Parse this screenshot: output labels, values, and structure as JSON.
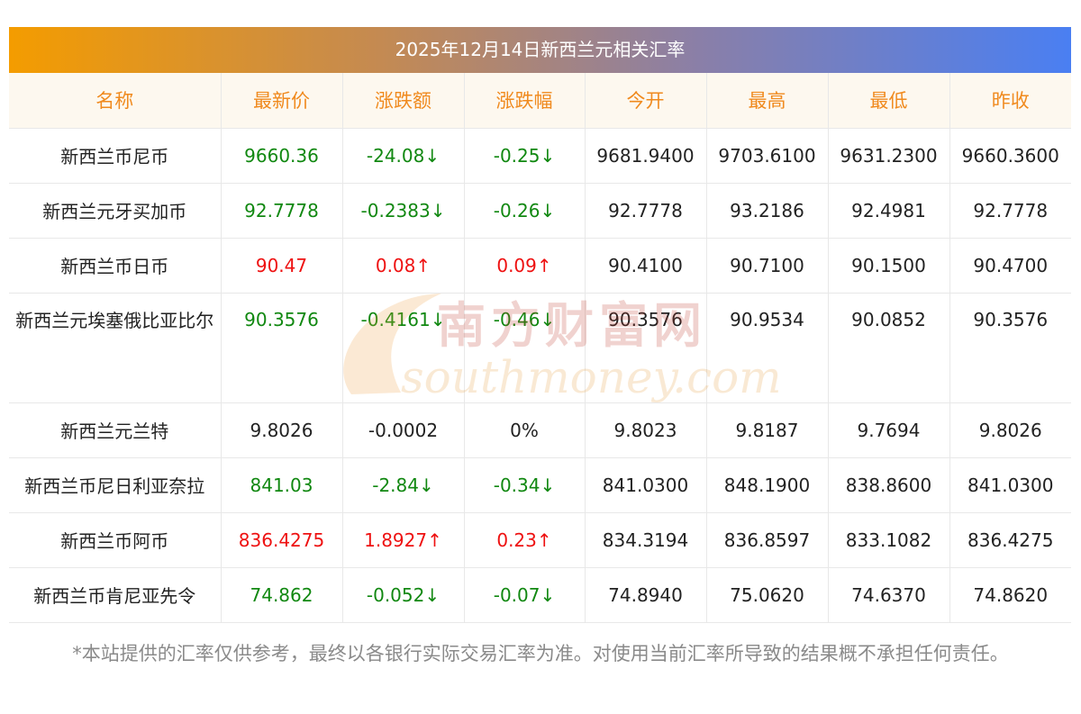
{
  "title": "2025年12月14日新西兰元相关汇率",
  "headers": [
    "名称",
    "最新价",
    "涨跌额",
    "涨跌幅",
    "今开",
    "最高",
    "最低",
    "昨收"
  ],
  "rows": [
    {
      "name": "新西兰币尼币",
      "latest": "9660.36",
      "change": "-24.08↓",
      "pct": "-0.25↓",
      "open": "9681.9400",
      "high": "9703.6100",
      "low": "9631.2300",
      "prev": "9660.3600",
      "trend": "down"
    },
    {
      "name": "新西兰元牙买加币",
      "latest": "92.7778",
      "change": "-0.2383↓",
      "pct": "-0.26↓",
      "open": "92.7778",
      "high": "93.2186",
      "low": "92.4981",
      "prev": "92.7778",
      "trend": "down"
    },
    {
      "name": "新西兰币日币",
      "latest": "90.47",
      "change": "0.08↑",
      "pct": "0.09↑",
      "open": "90.4100",
      "high": "90.7100",
      "low": "90.1500",
      "prev": "90.4700",
      "trend": "up"
    },
    {
      "name": "新西兰元埃塞俄比亚比尔",
      "latest": "90.3576",
      "change": "-0.4161↓",
      "pct": "-0.46↓",
      "open": "90.3576",
      "high": "90.9534",
      "low": "90.0852",
      "prev": "90.3576",
      "trend": "down"
    },
    {
      "name": "新西兰元兰特",
      "latest": "9.8026",
      "change": "-0.0002",
      "pct": "0%",
      "open": "9.8023",
      "high": "9.8187",
      "low": "9.7694",
      "prev": "9.8026",
      "trend": "flat"
    },
    {
      "name": "新西兰币尼日利亚奈拉",
      "latest": "841.03",
      "change": "-2.84↓",
      "pct": "-0.34↓",
      "open": "841.0300",
      "high": "848.1900",
      "low": "838.8600",
      "prev": "841.0300",
      "trend": "down"
    },
    {
      "name": "新西兰币阿币",
      "latest": "836.4275",
      "change": "1.8927↑",
      "pct": "0.23↑",
      "open": "834.3194",
      "high": "836.8597",
      "low": "833.1082",
      "prev": "836.4275",
      "trend": "up"
    },
    {
      "name": "新西兰币肯尼亚先令",
      "latest": "74.862",
      "change": "-0.052↓",
      "pct": "-0.07↓",
      "open": "74.8940",
      "high": "75.0620",
      "low": "74.6370",
      "prev": "74.8620",
      "trend": "down"
    }
  ],
  "watermark": {
    "cn": "南方财富网",
    "en": "southmoney.com"
  },
  "footnote": "*本站提供的汇率仅供参考，最终以各银行实际交易汇率为准。对使用当前汇率所导致的结果概不承担任何责任。",
  "colors": {
    "up": "#ee1111",
    "down": "#118811",
    "header_text": "#f08a1e",
    "header_bg": "#fdf8ef"
  }
}
